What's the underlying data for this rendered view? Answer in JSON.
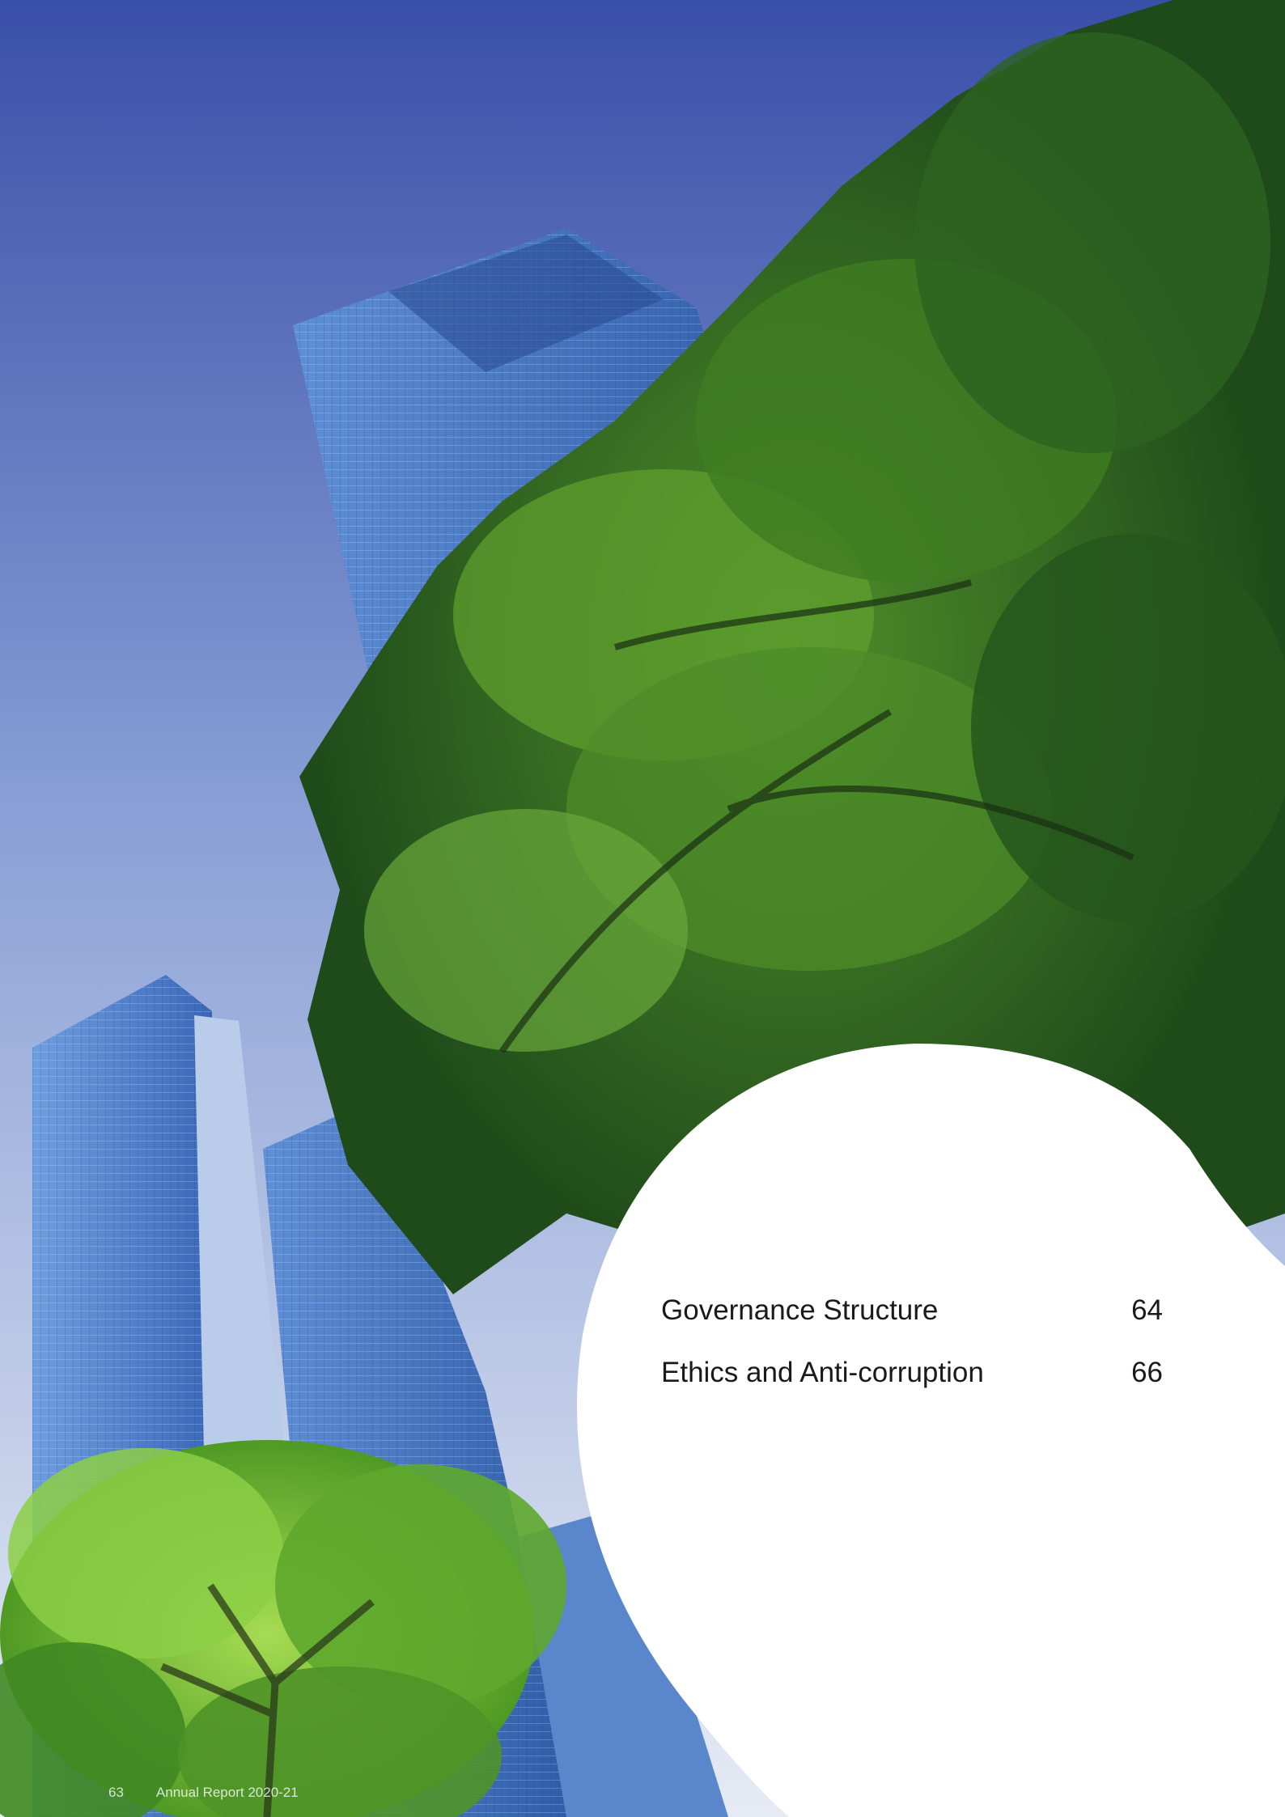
{
  "toc": [
    {
      "title": "Governance Structure",
      "page": "64"
    },
    {
      "title": "Ethics and Anti-corruption",
      "page": "66"
    }
  ],
  "footer": {
    "page_number": "63",
    "report_title": "Annual Report 2020-21"
  },
  "colors": {
    "sky_top": "#3a4fa8",
    "sky_bottom": "#dfe6f2",
    "foliage_dark": "#1f4a1a",
    "foliage_light": "#7fbf3a",
    "building": "#4a78c4"
  }
}
